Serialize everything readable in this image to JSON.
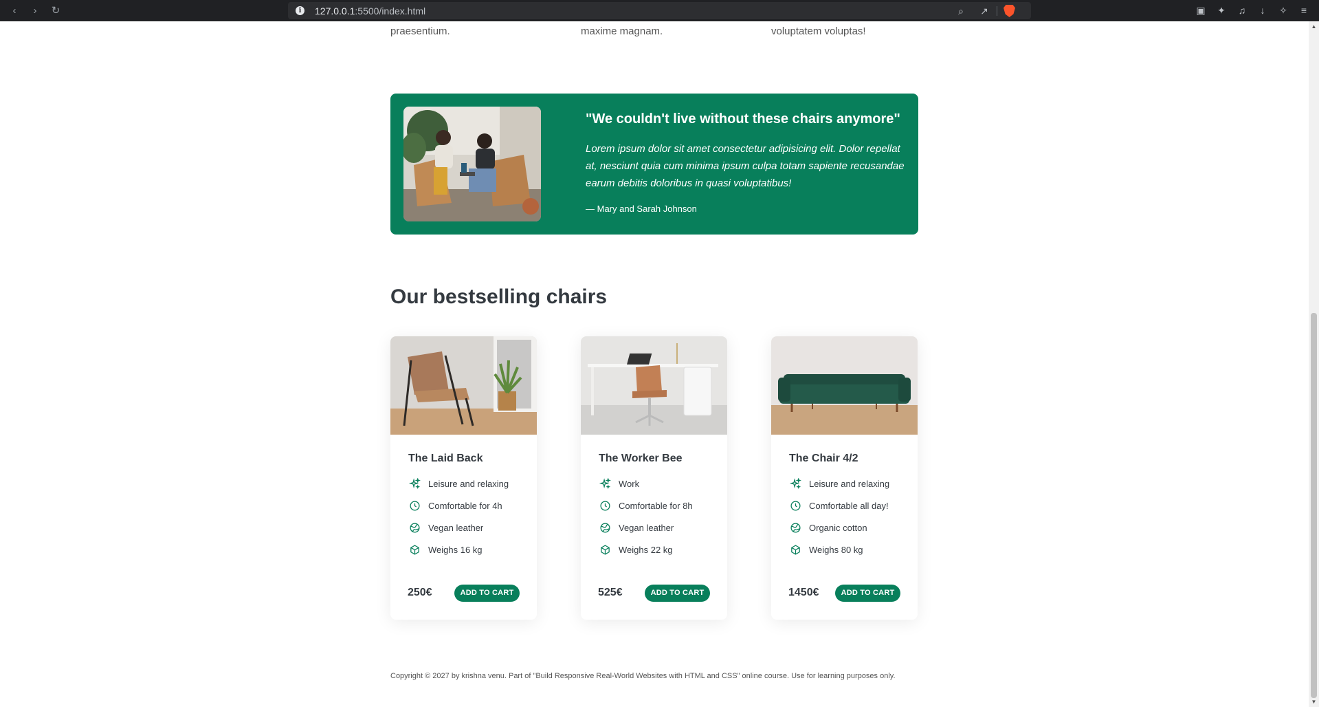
{
  "browser": {
    "url_host": "127.0.0.1",
    "url_rest": ":5500/index.html"
  },
  "features": [
    {
      "text": "praesentium."
    },
    {
      "text": "maxime magnam."
    },
    {
      "text": "voluptatem voluptas!"
    }
  ],
  "testimonial": {
    "title": "\"We couldn't live without these chairs anymore\"",
    "body": "Lorem ipsum dolor sit amet consectetur adipisicing elit. Dolor repellat at, nesciunt quia cum minima ipsum culpa totam sapiente recusandae earum debitis doloribus in quasi voluptatibus!",
    "author": "— Mary and Sarah Johnson"
  },
  "bestsellers": {
    "heading": "Our bestselling chairs",
    "cards": [
      {
        "title": "The Laid Back",
        "attributes": [
          {
            "icon": "sparkles-icon",
            "label": "Leisure and relaxing"
          },
          {
            "icon": "clock-icon",
            "label": "Comfortable for 4h"
          },
          {
            "icon": "globe-icon",
            "label": "Vegan leather"
          },
          {
            "icon": "cube-icon",
            "label": "Weighs 16 kg"
          }
        ],
        "price": "250€",
        "button": "ADD TO CART"
      },
      {
        "title": "The Worker Bee",
        "attributes": [
          {
            "icon": "sparkles-icon",
            "label": "Work"
          },
          {
            "icon": "clock-icon",
            "label": "Comfortable for 8h"
          },
          {
            "icon": "globe-icon",
            "label": "Vegan leather"
          },
          {
            "icon": "cube-icon",
            "label": "Weighs 22 kg"
          }
        ],
        "price": "525€",
        "button": "ADD TO CART"
      },
      {
        "title": "The Chair 4/2",
        "attributes": [
          {
            "icon": "sparkles-icon",
            "label": "Leisure and relaxing"
          },
          {
            "icon": "clock-icon",
            "label": "Comfortable all day!"
          },
          {
            "icon": "globe-icon",
            "label": "Organic cotton"
          },
          {
            "icon": "cube-icon",
            "label": "Weighs 80 kg"
          }
        ],
        "price": "1450€",
        "button": "ADD TO CART"
      }
    ]
  },
  "footer": {
    "text": "Copyright © 2027 by krishna venu. Part of \"Build Responsive Real-World Websites with HTML and CSS\" online course. Use for learning purposes only."
  },
  "colors": {
    "brand": "#087f5b",
    "text": "#343a40"
  }
}
